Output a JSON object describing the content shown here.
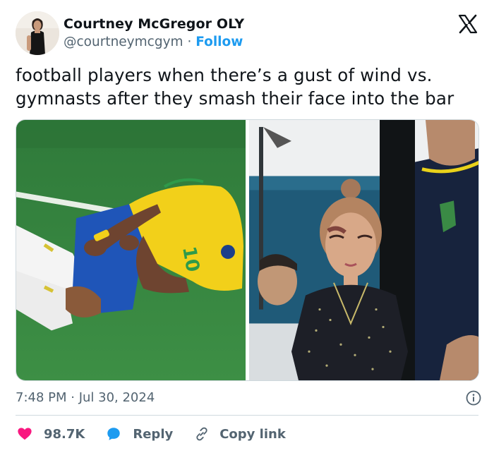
{
  "author": {
    "name": "Courtney McGregor OLY",
    "handle": "@courtneymcgym",
    "separator": "·",
    "follow_label": "Follow"
  },
  "tweet": {
    "text": "football players when there’s a gust of wind vs.\ngymnasts after they smash their face into the bar",
    "timestamp": "7:48 PM · Jul 30, 2024"
  },
  "media": {
    "left_jersey_number": "10"
  },
  "actions": {
    "like_count": "98.7K",
    "reply_label": "Reply",
    "copy_label": "Copy link"
  },
  "colors": {
    "like": "#f91880",
    "reply": "#1d9bf0",
    "link": "#1d9bf0",
    "secondary_text": "#536471"
  },
  "icons": [
    "x-logo-icon",
    "info-icon",
    "heart-icon",
    "reply-bubble-icon",
    "link-icon"
  ]
}
